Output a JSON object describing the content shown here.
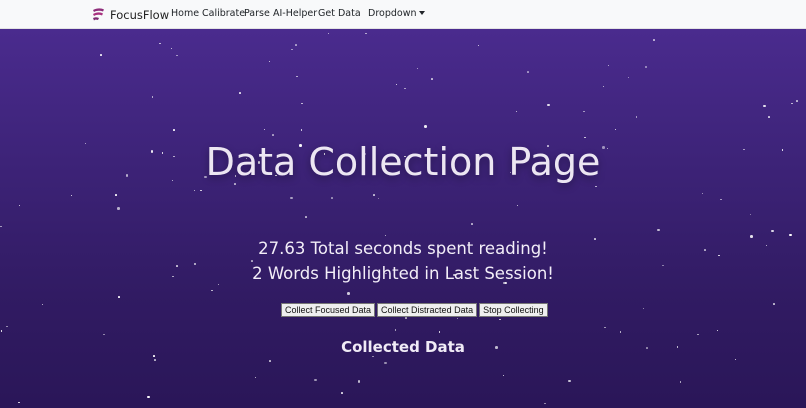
{
  "navbar": {
    "brand": "FocusFlow",
    "links": {
      "home": "Home",
      "calibrate": "Calibrate",
      "parse": "Parse",
      "ai_helper": "AI-Helper",
      "get_data": "Get Data",
      "dropdown": "Dropdown"
    }
  },
  "page": {
    "title": "Data Collection Page",
    "seconds_line": "27.63 Total seconds spent reading!",
    "words_line": "2 Words Highlighted in Last Session!",
    "buttons": {
      "focused": "Collect Focused Data",
      "distracted": "Collect Distracted Data",
      "stop": "Stop Collecting"
    },
    "section_heading": "Collected Data"
  },
  "colors": {
    "brand_icon": "#8e2d7a",
    "background_top": "#4a2b8e",
    "background_bottom": "#2a1658",
    "text": "#ece6f2"
  }
}
